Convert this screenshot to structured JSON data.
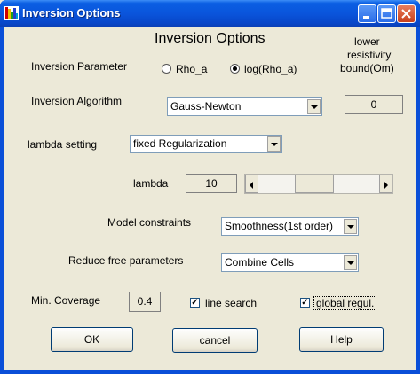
{
  "window": {
    "title": "Inversion Options"
  },
  "heading": "Inversion Options",
  "bound": {
    "label_line1": "lower",
    "label_line2": "resistivity",
    "label_line3": "bound(Om)",
    "value": "0"
  },
  "inversion_parameter": {
    "label": "Inversion Parameter",
    "options": [
      "Rho_a",
      "log(Rho_a)"
    ],
    "selected": "log(Rho_a)"
  },
  "inversion_algorithm": {
    "label": "Inversion Algorithm",
    "value": "Gauss-Newton"
  },
  "lambda_setting": {
    "label": "lambda setting",
    "value": "fixed Regularization"
  },
  "lambda": {
    "label": "lambda",
    "value": "10",
    "slider_level": 0.45
  },
  "model_constraints": {
    "label": "Model constraints",
    "value": "Smoothness(1st order)"
  },
  "reduce_params": {
    "label": "Reduce free parameters",
    "value": "Combine Cells"
  },
  "coverage": {
    "label": "Min. Coverage",
    "value": "0.4"
  },
  "line_search": {
    "label": "line search",
    "checked": true
  },
  "global_regul": {
    "label": "global regul.",
    "checked": true
  },
  "buttons": {
    "ok": "OK",
    "cancel": "cancel",
    "help": "Help"
  },
  "colors": {
    "title_bar": "#0a55dc",
    "face": "#ece9d8",
    "close_button": "#c8401c"
  }
}
